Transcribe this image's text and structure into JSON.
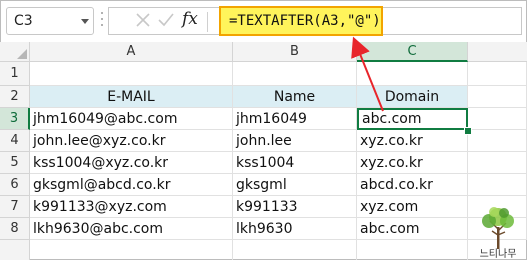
{
  "formula_bar": {
    "name_box": "C3",
    "formula": "=TEXTAFTER(A3,\"@\")"
  },
  "columns": [
    "A",
    "B",
    "C"
  ],
  "rows": [
    "1",
    "2",
    "3",
    "4",
    "5",
    "6",
    "7",
    "8"
  ],
  "table": {
    "headers": [
      "E-MAIL",
      "Name",
      "Domain"
    ],
    "data": [
      [
        "jhm16049@abc.com",
        "jhm16049",
        "abc.com"
      ],
      [
        "john.lee@xyz.co.kr",
        "john.lee",
        "xyz.co.kr"
      ],
      [
        "kss1004@xyz.co.kr",
        "kss1004",
        "xyz.co.kr"
      ],
      [
        "gksgml@abcd.co.kr",
        "gksgml",
        "abcd.co.kr"
      ],
      [
        "k991133@xyz.com",
        "k991133",
        "xyz.com"
      ],
      [
        "lkh9630@abc.com",
        "lkh9630",
        "abc.com"
      ]
    ]
  },
  "colors": {
    "accent": "#107c41",
    "header_fill": "#dbeef4",
    "formula_highlight": "#fff45b",
    "arrow": "#e8252b"
  },
  "watermark": "느티나무"
}
